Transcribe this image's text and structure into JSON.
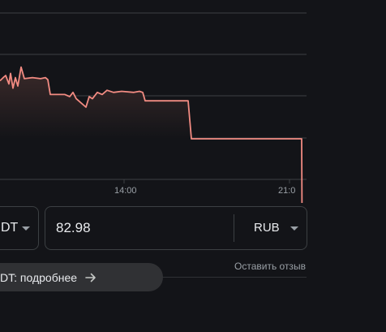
{
  "chart_data": {
    "type": "area",
    "x_ticks": [
      "14:00",
      "21:0"
    ],
    "values_relative": true,
    "values": [
      55,
      58,
      60,
      56,
      52,
      62,
      48,
      58,
      50,
      68,
      57,
      58,
      57,
      58,
      56,
      42,
      42,
      40,
      44,
      38,
      34,
      30,
      40,
      38,
      44,
      42,
      46,
      44,
      45,
      44,
      45,
      44,
      36,
      36,
      36,
      36,
      36,
      36,
      0,
      0,
      0,
      0,
      0,
      0,
      0,
      0,
      0,
      0,
      -160
    ],
    "grid": "horizontal",
    "colors": {
      "line": "#f28b82",
      "grid": "#3c4043",
      "fill_top": "#3b2a2a",
      "fill_bottom": "#131418"
    }
  },
  "converter": {
    "from_currency": "DT",
    "amount": "82.98",
    "to_currency": "RUB"
  },
  "feedback_link": "Оставить отзыв",
  "details_pill": {
    "label": "DT: подробнее",
    "icon": "arrow-right-icon"
  }
}
